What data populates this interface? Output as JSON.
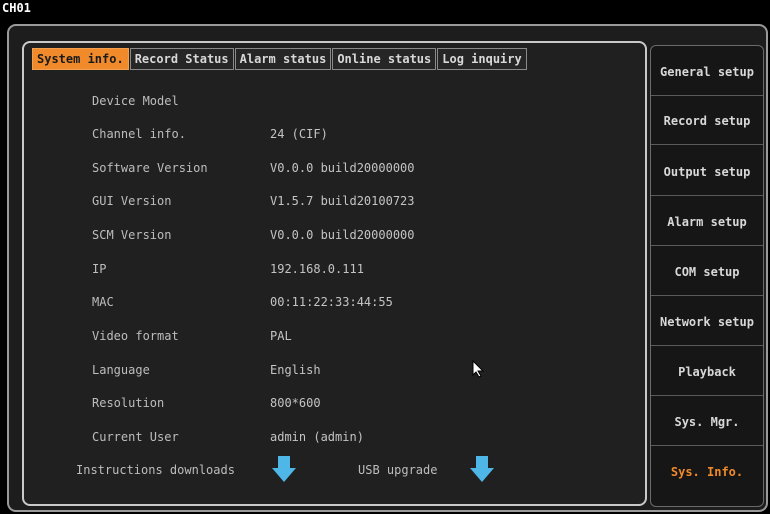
{
  "channel_label": "CH01",
  "tabs": [
    {
      "label": "System info.",
      "active": true
    },
    {
      "label": "Record Status",
      "active": false
    },
    {
      "label": "Alarm status",
      "active": false
    },
    {
      "label": "Online status",
      "active": false
    },
    {
      "label": "Log inquiry",
      "active": false
    }
  ],
  "info_rows": [
    {
      "label": "Device Model",
      "value": ""
    },
    {
      "label": "Channel info.",
      "value": "24 (CIF)"
    },
    {
      "label": "Software Version",
      "value": "V0.0.0 build20000000"
    },
    {
      "label": "GUI Version",
      "value": "V1.5.7 build20100723"
    },
    {
      "label": "SCM Version",
      "value": "V0.0.0 build20000000"
    },
    {
      "label": "IP",
      "value": "192.168.0.111"
    },
    {
      "label": "MAC",
      "value": "00:11:22:33:44:55"
    },
    {
      "label": "Video format",
      "value": "PAL"
    },
    {
      "label": "Language",
      "value": "English"
    },
    {
      "label": "Resolution",
      "value": "800*600"
    },
    {
      "label": "Current User",
      "value": "admin (admin)"
    }
  ],
  "instructions_download_label": "Instructions downloads",
  "usb_upgrade_label": "USB upgrade",
  "side_menu": [
    {
      "label": "General setup",
      "active": false
    },
    {
      "label": "Record setup",
      "active": false
    },
    {
      "label": "Output setup",
      "active": false
    },
    {
      "label": "Alarm setup",
      "active": false
    },
    {
      "label": "COM setup",
      "active": false
    },
    {
      "label": "Network setup",
      "active": false
    },
    {
      "label": "Playback",
      "active": false
    },
    {
      "label": "Sys. Mgr.",
      "active": false
    },
    {
      "label": "Sys. Info.",
      "active": true
    }
  ],
  "colors": {
    "accent": "#f08a2a",
    "download_arrow": "#4fb6e8",
    "background": "#202020"
  }
}
